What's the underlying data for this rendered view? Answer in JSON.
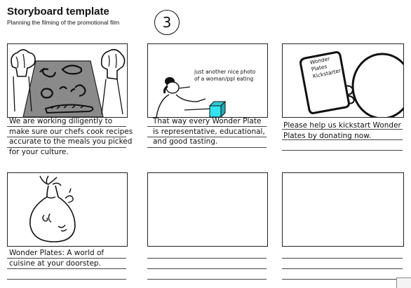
{
  "header": {
    "title": "Storyboard template",
    "subtitle": "Planning the filming of the promotional film",
    "page_number": "3"
  },
  "frames": [
    {
      "caption_lines": [
        "We are working diligently to",
        "make sure our chefs cook recipes",
        "accurate to the meals you picked",
        "for your culture."
      ]
    },
    {
      "note_lines": [
        "just another nice photo",
        "of a woman/ppl eating"
      ],
      "caption_lines": [
        "That way every Wonder Plate",
        "is representative, educational,",
        "and good tasting."
      ]
    },
    {
      "sign_lines": [
        "Wonder",
        "Plates",
        "Kickstarter"
      ],
      "caption_lines": [
        "Please help us kickstart Wonder",
        "Plates by donating now."
      ]
    },
    {
      "caption_lines": [
        "Wonder Plates: A world of",
        "cuisine at your doorstep."
      ]
    },
    {
      "caption_lines": []
    },
    {
      "caption_lines": []
    }
  ]
}
